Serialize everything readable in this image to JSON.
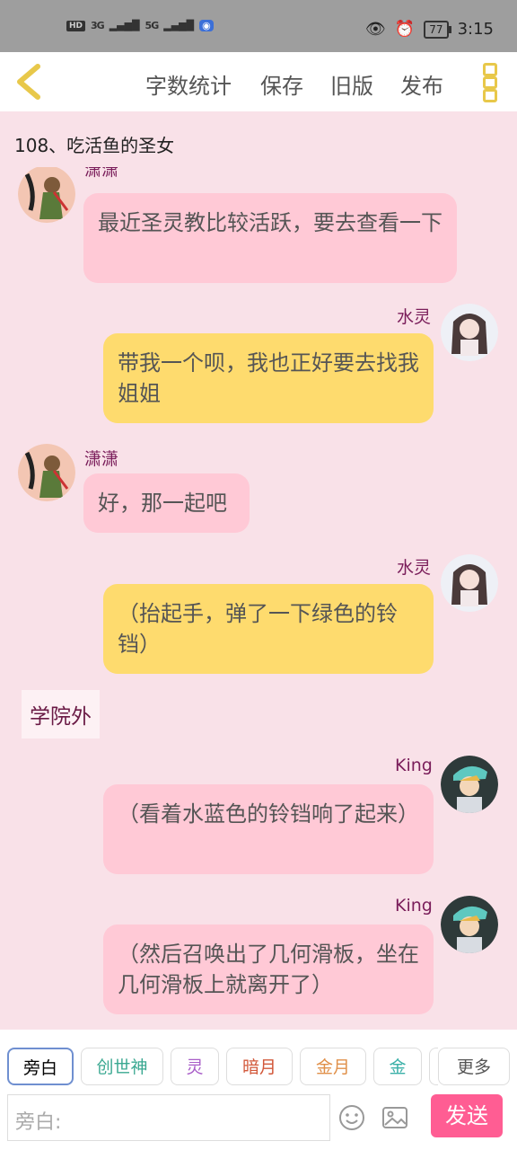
{
  "status_bar": {
    "hd": "HD",
    "signal1": "3G",
    "signal2": "5G",
    "battery": "77",
    "time": "3:15"
  },
  "topbar": {
    "word_count": "字数统计",
    "save": "保存",
    "old_version": "旧版",
    "publish": "发布"
  },
  "chapter_title": "108、吃活鱼的圣女",
  "messages": [
    {
      "name": "潇潇",
      "text": "最近圣灵教比较活跃，要去查看一下"
    },
    {
      "name": "水灵",
      "text": "带我一个呗，我也正好要去找我姐姐"
    },
    {
      "name": "潇潇",
      "text": "好，那一起吧"
    },
    {
      "name": "水灵",
      "text": "（抬起手，弹了一下绿色的铃铛）"
    },
    {
      "name": "King",
      "text": "（看着水蓝色的铃铛响了起来）"
    },
    {
      "name": "King",
      "text": "（然后召唤出了几何滑板，坐在几何滑板上就离开了）"
    }
  ],
  "scene_label": "学院外",
  "chips": [
    "旁白",
    "创世神",
    "灵",
    "暗月",
    "金月",
    "金",
    "更多"
  ],
  "chip_colors": [
    "#555555",
    "#3aa891",
    "#a85dc8",
    "#d2583a",
    "#e0904a",
    "#3ab0a8",
    "#555555"
  ],
  "input": {
    "placeholder": "旁白:"
  },
  "send_label": "发送",
  "colors": {
    "bg": "#f9e1e8",
    "pink_bubble": "#ffc9d6",
    "yellow_bubble": "#fedb6e",
    "name_color": "#7a1d5a",
    "send": "#ff5d93",
    "accent": "#e8c84a"
  }
}
